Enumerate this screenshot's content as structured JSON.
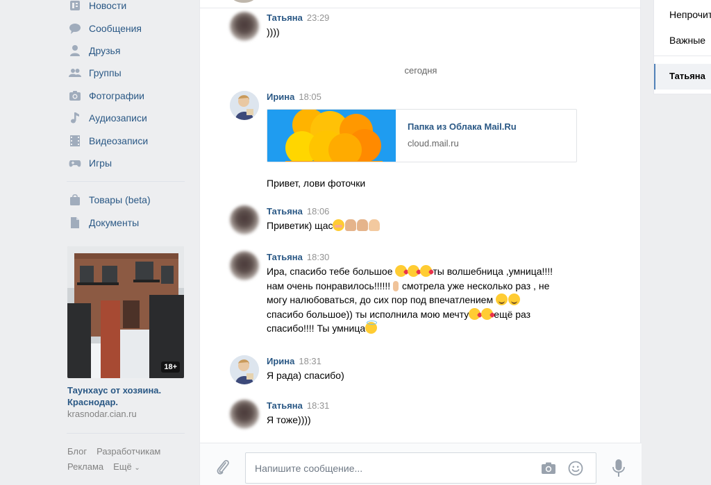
{
  "nav": {
    "items": [
      {
        "label": "Новости",
        "icon": "news-icon"
      },
      {
        "label": "Сообщения",
        "icon": "messages-icon"
      },
      {
        "label": "Друзья",
        "icon": "friends-icon"
      },
      {
        "label": "Группы",
        "icon": "groups-icon"
      },
      {
        "label": "Фотографии",
        "icon": "camera-icon"
      },
      {
        "label": "Аудиозаписи",
        "icon": "music-note-icon"
      },
      {
        "label": "Видеозаписи",
        "icon": "film-icon"
      },
      {
        "label": "Игры",
        "icon": "gamepad-icon"
      }
    ],
    "items2": [
      {
        "label": "Товары (beta)",
        "icon": "shopping-bag-icon"
      },
      {
        "label": "Документы",
        "icon": "document-icon"
      }
    ]
  },
  "ad": {
    "badge": "18+",
    "title": "Таунхаус от хозяина. Краснодар.",
    "domain": "krasnodar.cian.ru"
  },
  "footer": {
    "blog": "Блог",
    "developers": "Разработчикам",
    "ads": "Реклама",
    "more": "Ещё"
  },
  "chat": {
    "date_separator": "сегодня",
    "messages": [
      {
        "author": "Татьяна",
        "time": "23:29",
        "text": "))))"
      },
      {
        "author": "Ирина",
        "time": "18:05",
        "text": "Привет, лови фоточки"
      },
      {
        "author": "Татьяна",
        "time": "18:06",
        "text": "Приветик) щас"
      },
      {
        "author": "Татьяна",
        "time": "18:30",
        "line1": "Ира, спасибо тебе большое ",
        "line1b": "ты волшебница ,умница!!!!",
        "line2": "нам очень понравилось!!!!!! ",
        "line2b": "смотрела уже несколько раз , не",
        "line3": "могу налюбоваться, до сих пор под впечатлением ",
        "line4": "спасибо большое)) ты исполнила мою мечту",
        "line4b": "ещё раз",
        "line5": "спасибо!!!! Ты умница"
      },
      {
        "author": "Ирина",
        "time": "18:31",
        "text": "Я рада) спасибо)"
      },
      {
        "author": "Татьяна",
        "time": "18:31",
        "text": "Я тоже))))"
      }
    ],
    "link_card": {
      "title": "Папка из Облака Mail.Ru",
      "domain": "cloud.mail.ru"
    },
    "composer_placeholder": "Напишите сообщение..."
  },
  "right_panel": {
    "filter_unread": "Непрочитанные",
    "filter_important": "Важные",
    "active_conversation": "Татьяна"
  },
  "colors": {
    "link": "#2a5885",
    "page_bg": "#edeef0",
    "accent": "#5181b8"
  }
}
